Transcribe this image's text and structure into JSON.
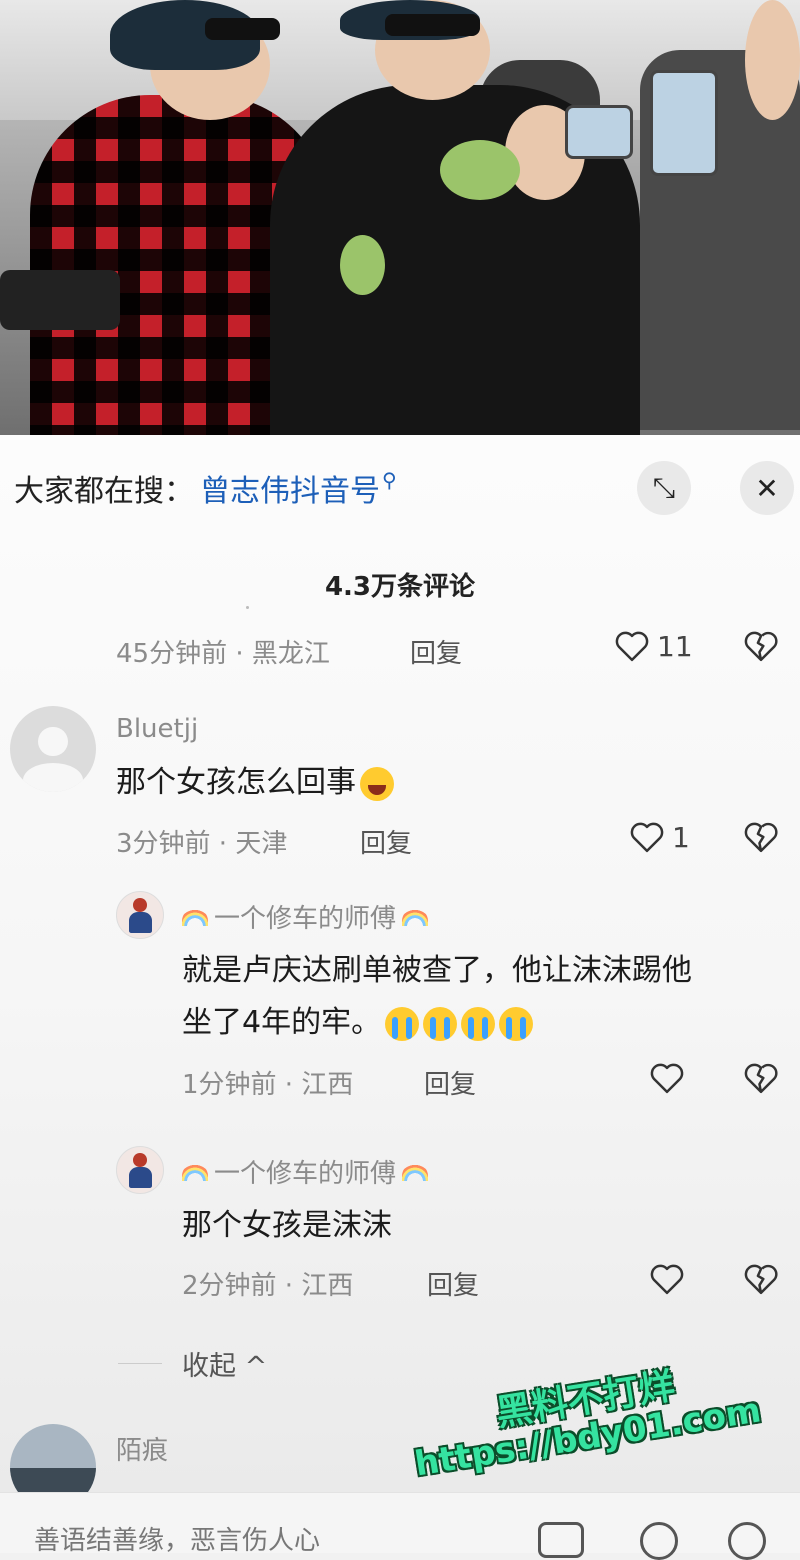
{
  "search": {
    "label": "大家都在搜：",
    "term": "曾志伟抖音号",
    "search_icon": "search-icon"
  },
  "toolbar": {
    "expand_icon": "expand-icon",
    "close_icon": "close-icon",
    "close_glyph": "✕",
    "expand_glyph": "⤡"
  },
  "comments_count": "4.3万条评论",
  "prev_comment": {
    "time_location": "45分钟前 · 黑龙江",
    "reply": "回复",
    "likes": "11"
  },
  "comments": [
    {
      "user": "Bluetjj",
      "text": "那个女孩怎么回事",
      "emoji": "laughing-crying-emoji",
      "time_location": "3分钟前 · 天津",
      "reply": "回复",
      "likes": "1"
    }
  ],
  "replies": [
    {
      "user": "一个修车的师傅",
      "text_line1": "就是卢庆达刷单被查了，他让沫沫踢他",
      "text_line2": "坐了4年的牢。",
      "emoji": "crying-emoji",
      "time_location": "1分钟前 · 江西",
      "reply": "回复"
    },
    {
      "user": "一个修车的师傅",
      "text_line1": "那个女孩是沫沫",
      "time_location": "2分钟前 · 江西",
      "reply": "回复"
    }
  ],
  "collapse_label": "收起 ^",
  "next_comment": {
    "user": "陌痕"
  },
  "input": {
    "placeholder": "善语结善缘，恶言伤人心"
  },
  "watermark": {
    "line1": "黑料不打烊",
    "line2": "https://bdy01.com"
  }
}
